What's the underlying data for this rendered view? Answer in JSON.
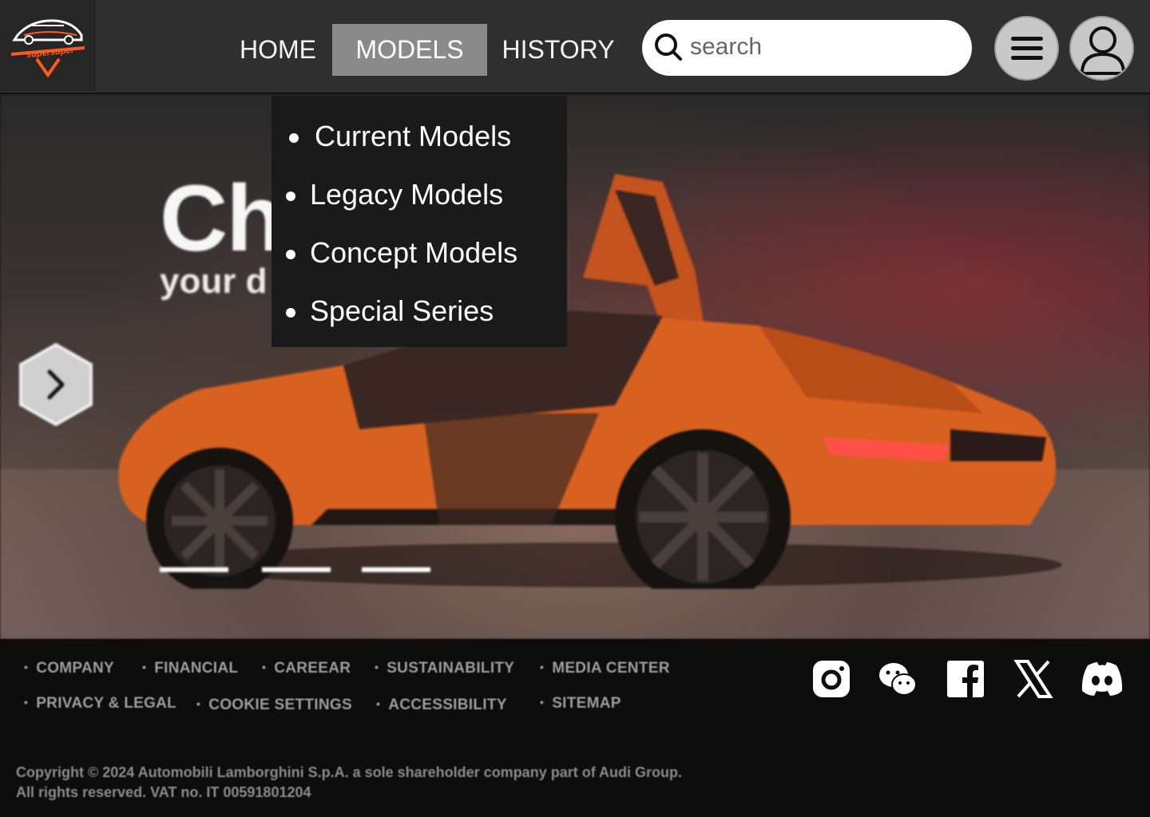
{
  "brand": {
    "logo_text": "supersuper",
    "accent": "#ff5a1f"
  },
  "nav": {
    "home": "HOME",
    "models": "MODELS",
    "history": "HISTORY",
    "active": "MODELS"
  },
  "search": {
    "placeholder": "search"
  },
  "header_icons": [
    "search-icon",
    "menu-icon",
    "user-icon"
  ],
  "dropdown": {
    "items": [
      "Current Models",
      "Legacy Models",
      "Concept Models",
      "Special Series"
    ]
  },
  "hero": {
    "title": "Ch",
    "subtitle": "your d",
    "slide_count": 3
  },
  "footer": {
    "links_row1": [
      "COMPANY",
      "FINANCIAL",
      "CAREEAR",
      "SUSTAINABILITY",
      "MEDIA CENTER"
    ],
    "links_row2": [
      "PRIVACY & LEGAL",
      "COOKIE SETTINGS",
      "ACCESSIBILITY",
      "SITEMAP"
    ],
    "social": [
      "instagram-icon",
      "wechat-icon",
      "facebook-icon",
      "x-icon",
      "discord-icon"
    ],
    "copyright_line1": "Copyright © 2024 Automobili Lamborghini S.p.A. a sole shareholder company part of Audi Group.",
    "copyright_line2": "All rights reserved. VAT no. IT 00591801204"
  }
}
